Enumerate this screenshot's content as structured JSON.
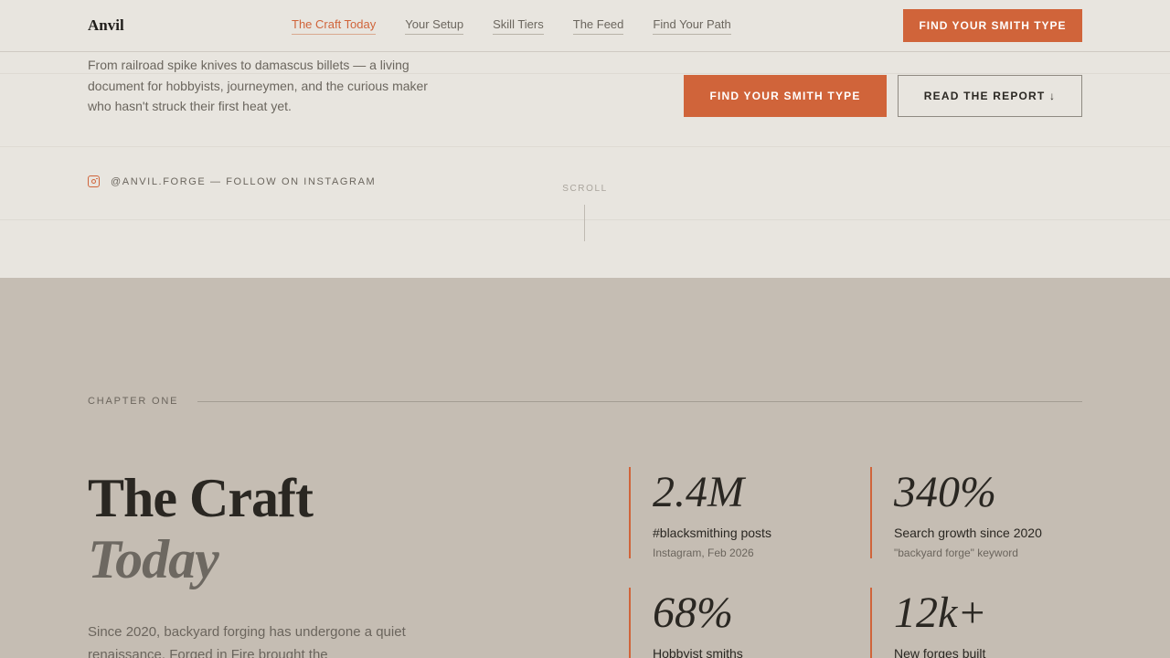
{
  "nav": {
    "logo": "Anvil",
    "links": [
      {
        "label": "The Craft Today",
        "active": true
      },
      {
        "label": "Your Setup",
        "active": false
      },
      {
        "label": "Skill Tiers",
        "active": false
      },
      {
        "label": "The Feed",
        "active": false
      },
      {
        "label": "Find Your Path",
        "active": false
      }
    ],
    "cta_label": "FIND YOUR SMITH TYPE"
  },
  "hero": {
    "description": "From railroad spike knives to damascus billets — a living document for hobbyists, journeymen, and the curious maker who hasn't struck their first heat yet.",
    "primary_button": "FIND YOUR SMITH TYPE",
    "secondary_button": "READ THE REPORT ↓",
    "instagram_text": "@ANVIL.FORGE — FOLLOW ON INSTAGRAM",
    "scroll_label": "SCROLL"
  },
  "chapter": {
    "label": "CHAPTER ONE",
    "title_line1": "The Craft",
    "title_line2": "Today",
    "body": "Since 2020, backyard forging has undergone a quiet renaissance. Forged in Fire brought the",
    "stats": [
      {
        "value": "2.4M",
        "label": "#blacksmithing posts",
        "sub": "Instagram, Feb 2026"
      },
      {
        "value": "340%",
        "label": "Search growth since 2020",
        "sub": "\"backyard forge\" keyword"
      },
      {
        "value": "68%",
        "label": "Hobbyist smiths",
        "sub": ""
      },
      {
        "value": "12k+",
        "label": "New forges built",
        "sub": ""
      }
    ]
  },
  "colors": {
    "accent": "#d0643a",
    "hero_bg": "#e8e5df",
    "section_bg": "#c5bdb3"
  }
}
